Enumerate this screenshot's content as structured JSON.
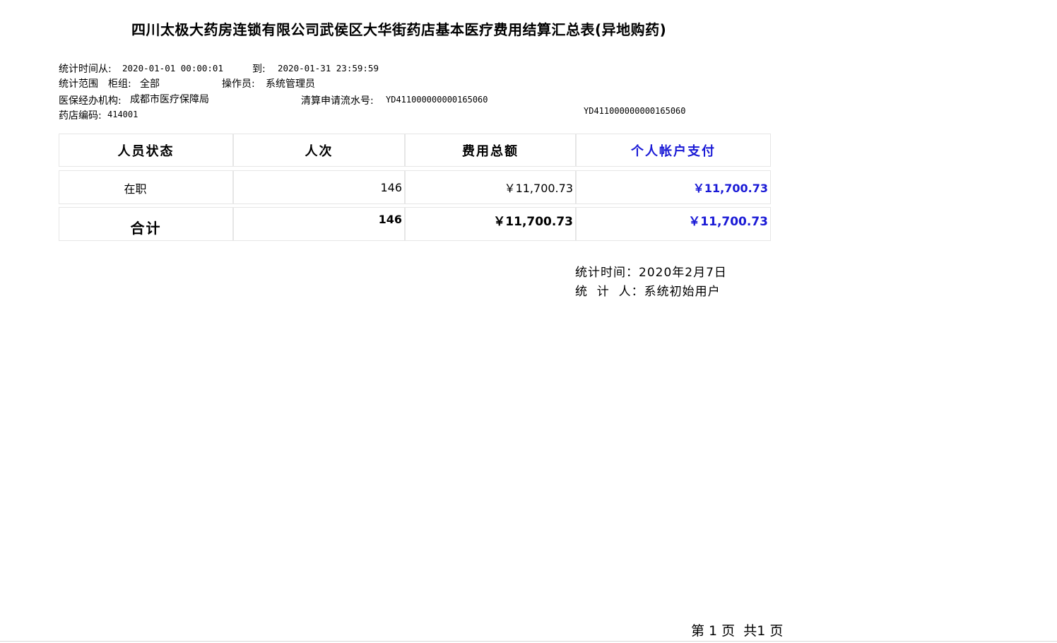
{
  "title": "四川太极大药房连锁有限公司武侯区大华街药店基本医疗费用结算汇总表(异地购药)",
  "meta": {
    "period_from_label": "统计时间从:",
    "period_from_value": "2020-01-01 00:00:01",
    "period_to_label": "到:",
    "period_to_value": "2020-01-31 23:59:59",
    "scope_label": "统计范围",
    "counter_group_label": "柜组:",
    "counter_group_value": "全部",
    "operator_label": "操作员:",
    "operator_value": "系统管理员",
    "agency_label": "医保经办机构:",
    "agency_value": "成都市医疗保障局",
    "serial_label": "清算申请流水号:",
    "serial_value": "YD411000000000165060",
    "serial_repeat": "YD411000000000165060",
    "store_code_label": "药店编码:",
    "store_code_value": "414001"
  },
  "table": {
    "headers": [
      "人员状态",
      "人次",
      "费用总额",
      "个人帐户支付"
    ],
    "rows": [
      {
        "status": "在职",
        "count": "146",
        "total": "￥11,700.73",
        "personal": "￥11,700.73"
      }
    ],
    "totals": {
      "status": "合计",
      "count": "146",
      "total": "￥11,700.73",
      "personal": "￥11,700.73"
    }
  },
  "footer": {
    "stat_time": "统计时间：2020年2月7日",
    "stat_person": "统  计  人：系统初始用户"
  },
  "pagination": "第 1 页  共1 页",
  "colors": {
    "accent_blue": "#1a1ad6",
    "border": "#e6e6e6"
  }
}
